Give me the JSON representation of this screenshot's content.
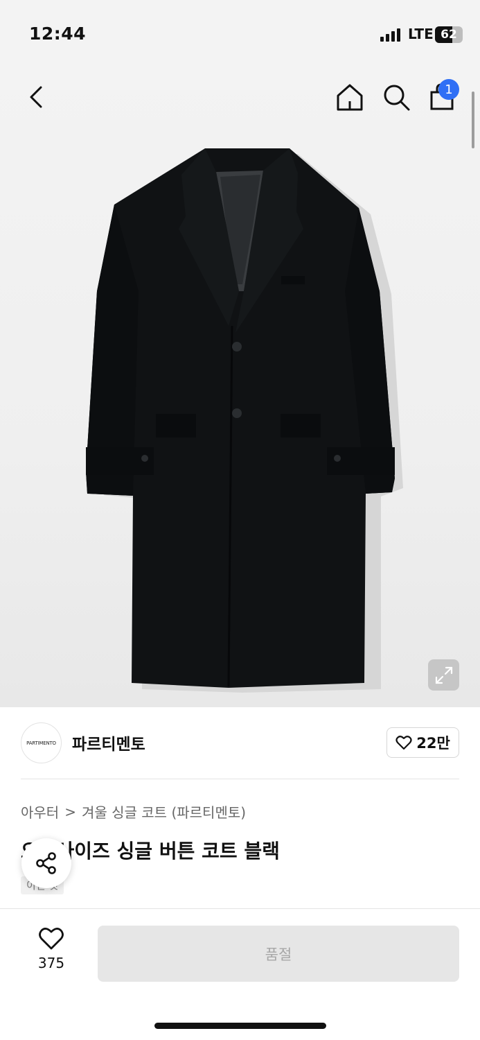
{
  "status_bar": {
    "time": "12:44",
    "network": "LTE",
    "battery": "62",
    "battery_level": 0.62
  },
  "nav": {
    "back_icon": "chevron-left-icon",
    "home_icon": "home-icon",
    "search_icon": "search-icon",
    "cart_icon": "shopping-bag-icon",
    "cart_count": "1",
    "badge_color": "#2f6ff5"
  },
  "product_image": {
    "subject": "black-single-button-coat",
    "expand_icon": "expand-icon"
  },
  "brand": {
    "logo_text": "PARTIMENTO",
    "name": "파르티멘토",
    "likes": "22만"
  },
  "breadcrumb": {
    "category": "아우터",
    "separator": ">",
    "subcategory": "겨울 싱글 코트 (파르티멘토)"
  },
  "product": {
    "title": "오버사이즈 싱글 버튼 코트 블랙",
    "tag": "이런 것"
  },
  "bottom_bar": {
    "like_count": "375",
    "soldout_label": "품절"
  }
}
